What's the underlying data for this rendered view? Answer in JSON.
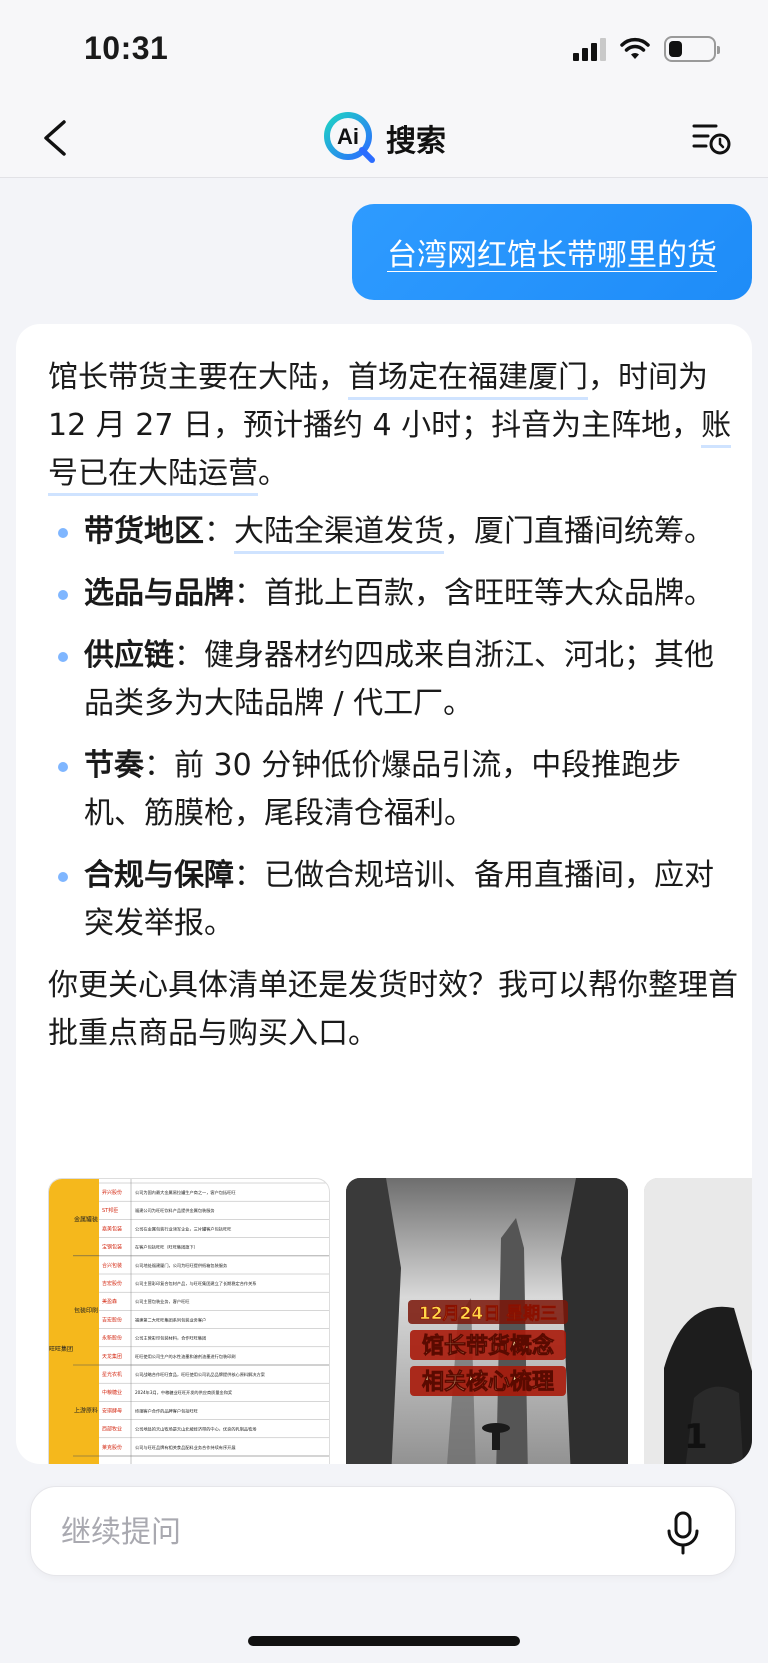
{
  "status_bar": {
    "time": "10:31",
    "battery_level": 0.3
  },
  "nav": {
    "title": "搜索",
    "logo_text": "Ai"
  },
  "query": {
    "text": "台湾网红馆长带哪里的货"
  },
  "answer": {
    "intro": {
      "p1": "馆长带货主要在大陆，",
      "hl1": "首场定在福建厦门",
      "p2": "，时间为 12 月 27 日，预计播约 4 小时；抖音为主阵地，",
      "hl2": "账号已在大陆运营",
      "p3": "。"
    },
    "bullets": [
      {
        "label": "带货地区",
        "sep": "：",
        "hl": "大陆全渠道发货",
        "text": "，厦门直播间统筹。"
      },
      {
        "label": "选品与品牌",
        "sep": "：",
        "hl": "",
        "text": "首批上百款，含旺旺等大众品牌。"
      },
      {
        "label": "供应链",
        "sep": "：",
        "hl": "",
        "text": "健身器材约四成来自浙江、河北；其他品类多为大陆品牌 / 代工厂。"
      },
      {
        "label": "节奏",
        "sep": "：",
        "hl": "",
        "text": "前 30 分钟低价爆品引流，中段推跑步机、筋膜枪，尾段清仓福利。"
      },
      {
        "label": "合规与保障",
        "sep": "：",
        "hl": "",
        "text": "已做合规培训、备用直播间，应对突发举报。"
      }
    ],
    "follow_up": "你更关心具体清单还是发货时效？我可以帮你整理首批重点商品与购买入口。"
  },
  "thumbnails": {
    "table": {
      "group": "旺旺集团",
      "categories": [
        "金属罐装",
        "包装印刷",
        "上游原料"
      ],
      "rows": [
        {
          "company": "昇兴股份",
          "desc": "公司为国内最大金属易拉罐生产商之一，客户包括旺旺"
        },
        {
          "company": "ST邦臣",
          "desc": "福建公司为旺旺饮料产品提供金属包装服务"
        },
        {
          "company": "嘉美包装",
          "desc": "公司在金属包装行业领军企业，三片罐客户包括旺旺"
        },
        {
          "company": "宝钢包装",
          "desc": "在客户包括旺旺（旺旺集团旗下）"
        },
        {
          "company": "合兴包装",
          "desc": "公司地处福建厦门，公司为旺旺提供纸箱包装服务"
        },
        {
          "company": "吉宏股份",
          "desc": "公司主营彩印复合包材产品，与旺旺集团建立了长期稳定合作关系"
        },
        {
          "company": "美盈森",
          "desc": "公司主营包装业务，客户旺旺"
        },
        {
          "company": "吉宏股份",
          "desc": "福建第二大旺旺集团系列包装业务客户"
        },
        {
          "company": "永新股份",
          "desc": "公司主营彩印包装材料，合作旺旺集团"
        },
        {
          "company": "天龙集团",
          "desc": "旺旺使用公司生产的水性油墨和溶剂油墨进行包装印刷"
        },
        {
          "company": "星光农机",
          "desc": "公司战略合作旺旺食品，旺旺使用公司乳品品牌提供核心原料解决方案"
        },
        {
          "company": "中粮糖业",
          "desc": "2024年3月，中粮糖业旺旺开发的供应商质量金和奖"
        },
        {
          "company": "安琪酵母",
          "desc": "终端客户合作的品牌客户包括旺旺"
        },
        {
          "company": "西部牧业",
          "desc": "公司地处的天山牧场是天山北坡经济带的中心，优良的乳制品牧场"
        },
        {
          "company": "莱克股份",
          "desc": "公司与旺旺品牌有相关食品配料业务合作持续有序开展"
        }
      ]
    },
    "poster": {
      "line1": "12月24日 星期三",
      "line2": "馆长带货概念",
      "line3": "相关核心梳理"
    },
    "third_partial_text": "1"
  },
  "input": {
    "placeholder": "继续提问"
  }
}
